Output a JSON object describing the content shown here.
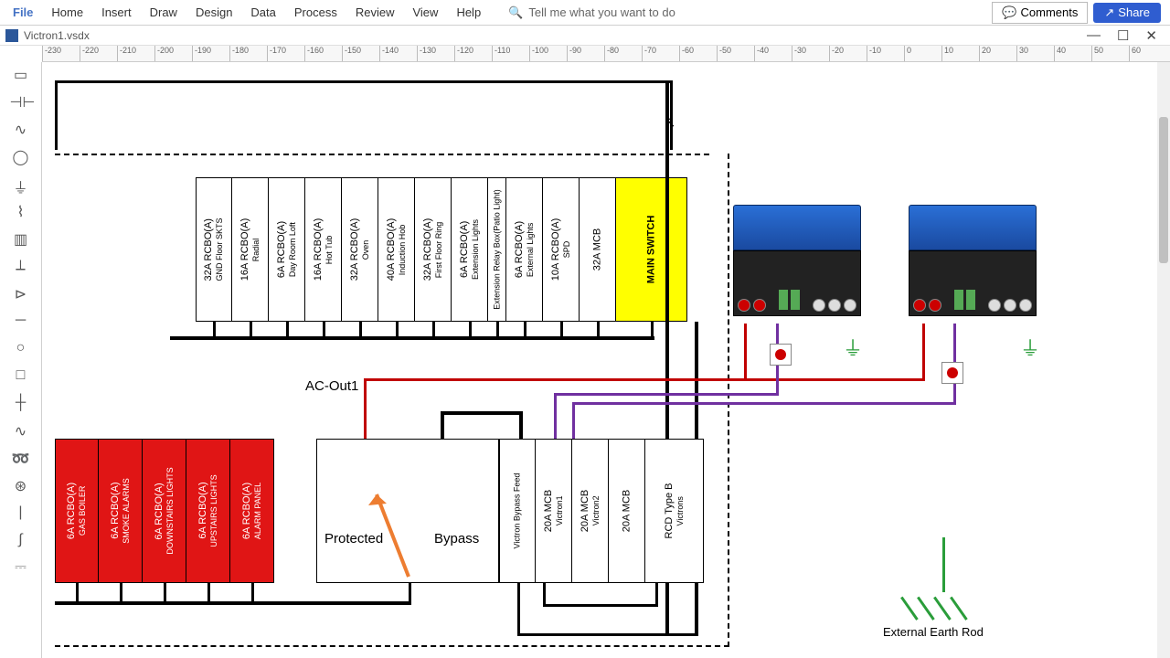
{
  "menu": {
    "file": "File",
    "home": "Home",
    "insert": "Insert",
    "draw": "Draw",
    "design": "Design",
    "data": "Data",
    "process": "Process",
    "review": "Review",
    "view": "View",
    "help": "Help"
  },
  "search": {
    "placeholder": "Tell me what you want to do"
  },
  "buttons": {
    "comments": "Comments",
    "share": "Share"
  },
  "doc": {
    "filename": "Victron1.vsdx"
  },
  "ruler_ticks": [
    "-230",
    "-220",
    "-210",
    "-200",
    "-190",
    "-180",
    "-170",
    "-160",
    "-150",
    "-140",
    "-130",
    "-120",
    "-110",
    "-100",
    "-90",
    "-80",
    "-70",
    "-60",
    "-50",
    "-40",
    "-30",
    "-20",
    "-10",
    "0",
    "10",
    "20",
    "30",
    "40",
    "50",
    "60"
  ],
  "upper_breakers": [
    {
      "l1": "32A RCBO(A)",
      "l2": "GND Floor SKTS"
    },
    {
      "l1": "16A RCBO(A)",
      "l2": "Radial"
    },
    {
      "l1": "6A RCBO(A)",
      "l2": "Day Room Loft"
    },
    {
      "l1": "16A RCBO(A)",
      "l2": "Hot Tub"
    },
    {
      "l1": "32A RCBO(A)",
      "l2": "Oven"
    },
    {
      "l1": "40A RCBO(A)",
      "l2": "Induction Hob"
    },
    {
      "l1": "32A RCBO(A)",
      "l2": "First Floor Ring"
    },
    {
      "l1": "6A RCBO(A)",
      "l2": "Extension Lights"
    },
    {
      "l1": "",
      "l2": "Extension Relay Box(Patio Light)",
      "narrow": true
    },
    {
      "l1": "6A RCBO(A)",
      "l2": "External Lights"
    },
    {
      "l1": "10A RCBO(A)",
      "l2": "SPD"
    },
    {
      "l1": "32A MCB",
      "l2": ""
    },
    {
      "l1": "MAIN SWITCH",
      "l2": "",
      "yellow": true
    }
  ],
  "lower_left_breakers": [
    {
      "l1": "6A RCBO(A)",
      "l2": "GAS BOILER"
    },
    {
      "l1": "6A RCBO(A)",
      "l2": "SMOKE ALARMS"
    },
    {
      "l1": "6A RCBO(A)",
      "l2": "DOWNSTAIRS LIGHTS"
    },
    {
      "l1": "6A RCBO(A)",
      "l2": "UPSTAIRS LIGHTS"
    },
    {
      "l1": "6A RCBO(A)",
      "l2": "ALARM PANEL"
    }
  ],
  "bypass": {
    "protected": "Protected",
    "bypass": "Bypass"
  },
  "lower_right_breakers": [
    {
      "l1": "",
      "l2": "Victron Bypass Feed"
    },
    {
      "l1": "20A MCB",
      "l2": "Victron1"
    },
    {
      "l1": "20A MCB",
      "l2": "Victron2"
    },
    {
      "l1": "20A MCB",
      "l2": ""
    },
    {
      "l1": "RCD Type B",
      "l2": "Victrons",
      "wide": true
    }
  ],
  "labels": {
    "acout": "AC-Out1",
    "earthrod": "External Earth Rod"
  }
}
